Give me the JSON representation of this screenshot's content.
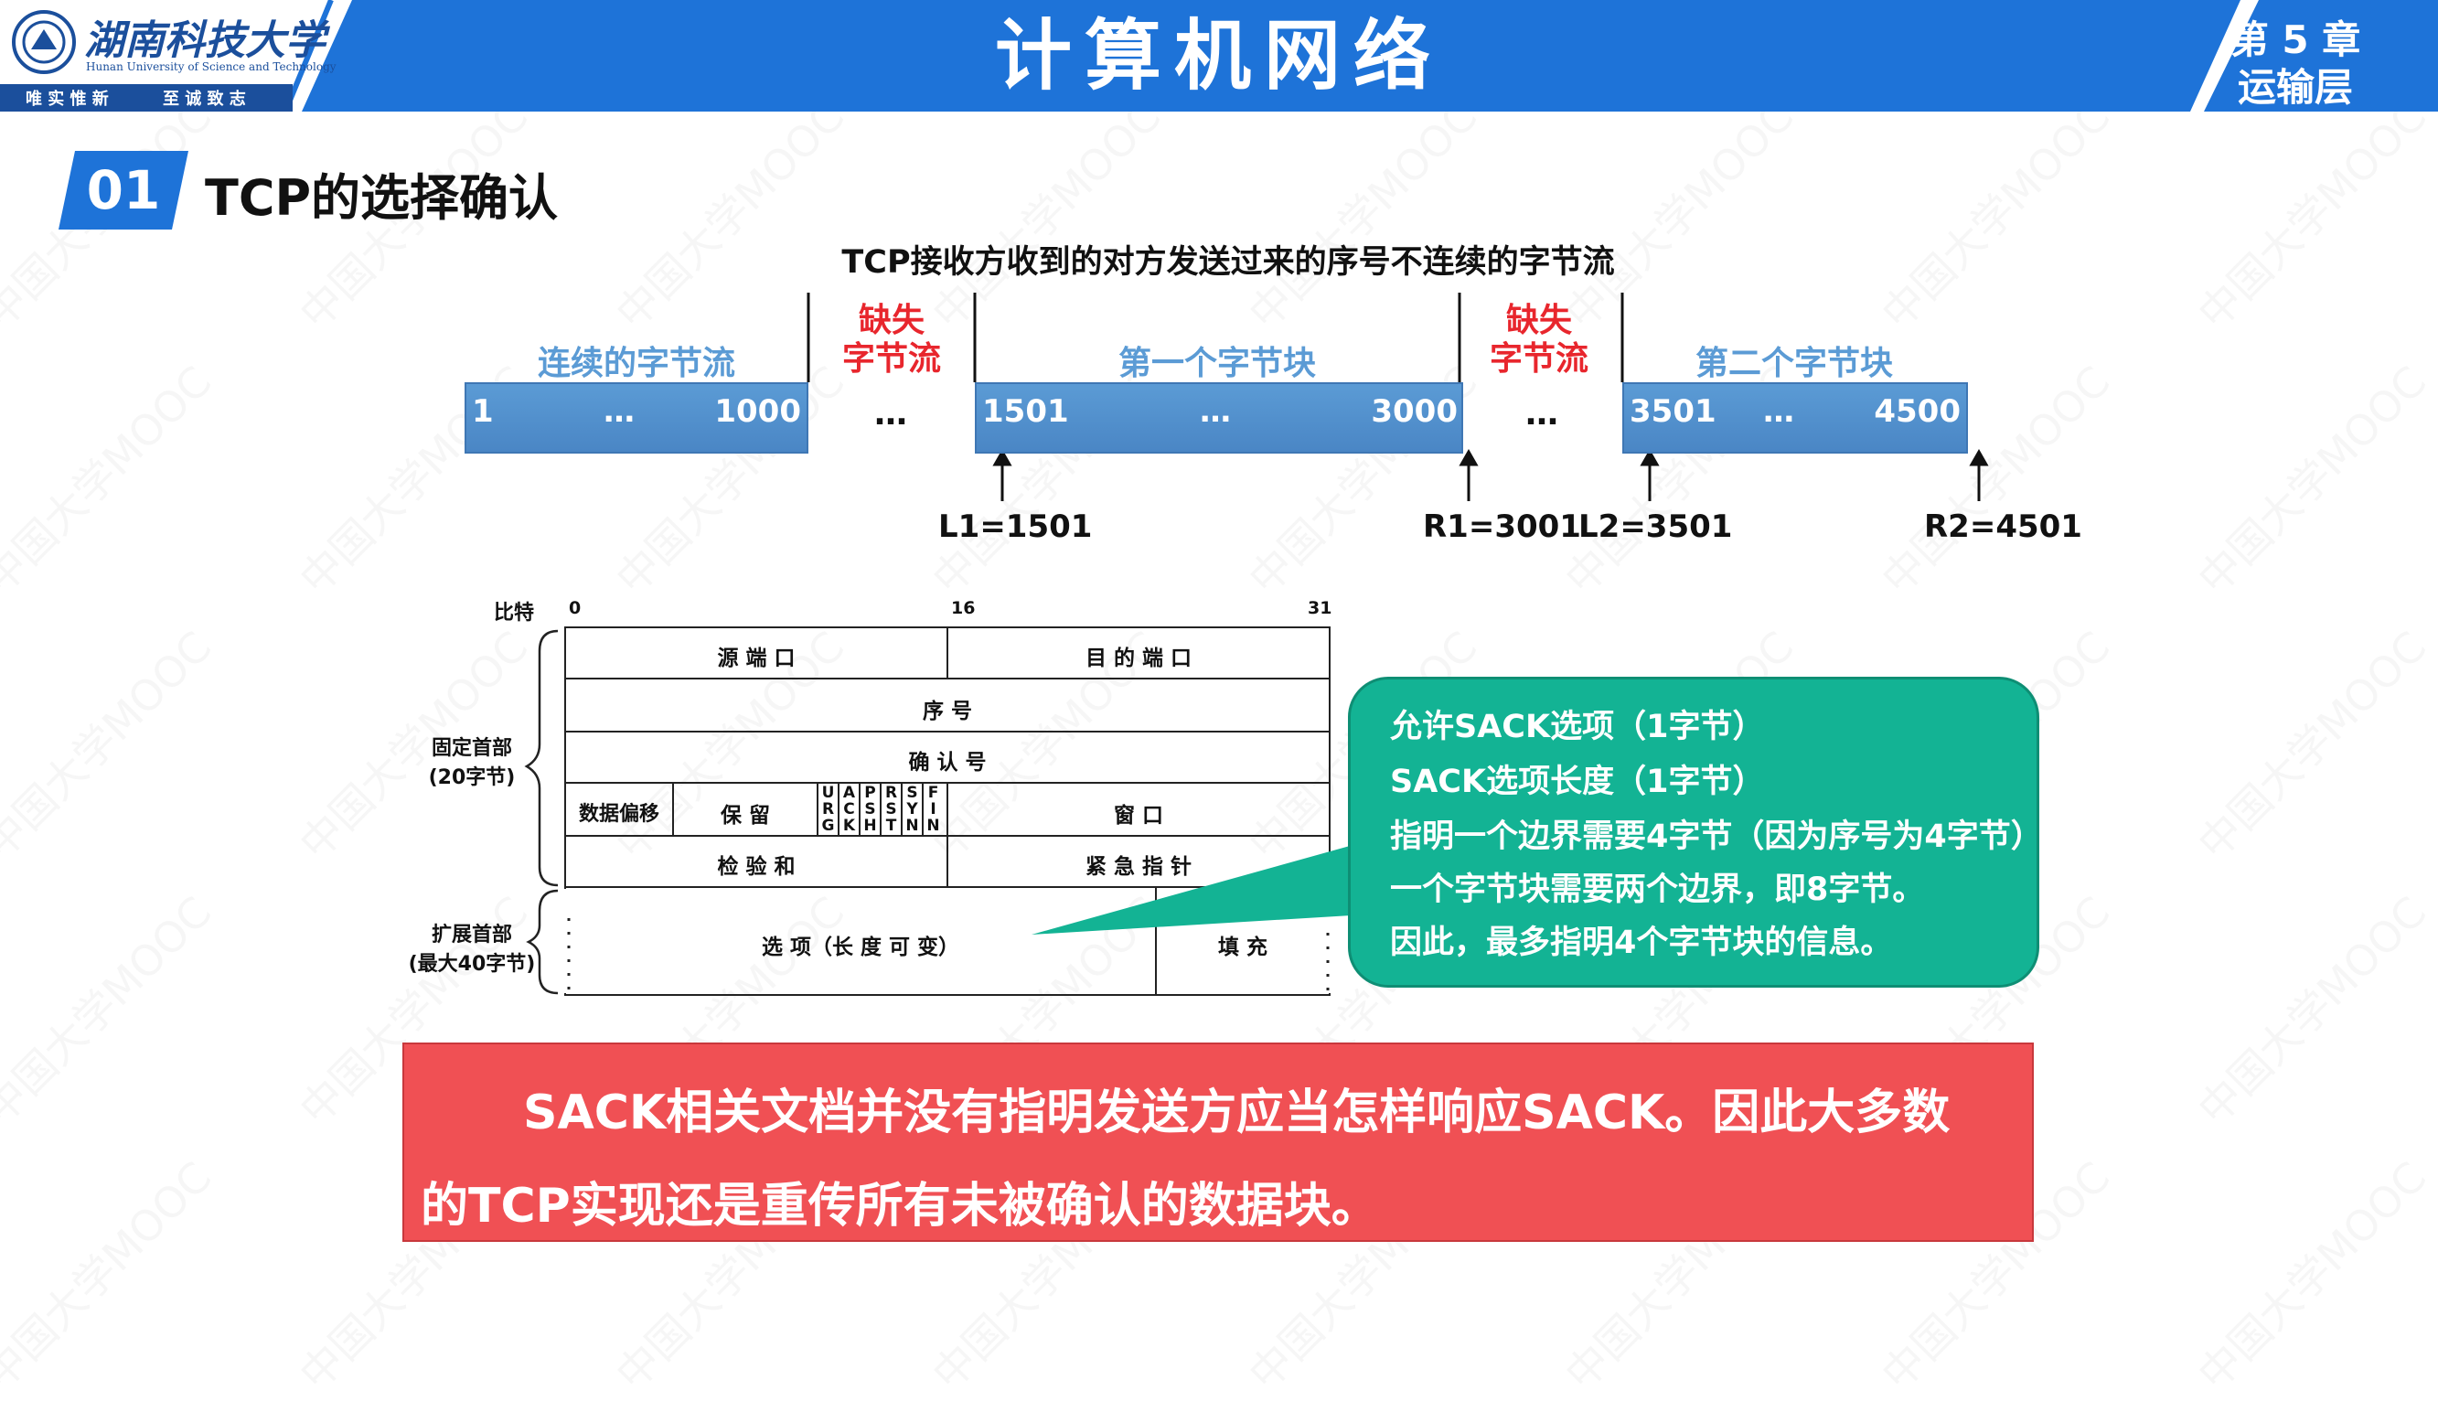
{
  "header": {
    "logo_name": "湖南科技大学",
    "logo_subtitle": "Hunan University of Science and Technology",
    "logo_motto_left": "唯 实 惟 新",
    "logo_motto_right": "至 诚 致 志",
    "title": "计算机网络",
    "chapter_line1": "第 5 章",
    "chapter_line2": "运输层",
    "colors": {
      "band": "#1e73d8",
      "band_light": "#ffffff"
    }
  },
  "section": {
    "number": "01",
    "title": "TCP的选择确认"
  },
  "stream_diagram": {
    "caption": "TCP接收方收到的对方发送过来的序号不连续的字节流",
    "blocks": [
      {
        "label": "连续的字节流",
        "start": "1",
        "mid": "…",
        "end": "1000"
      },
      {
        "label": "第一个字节块",
        "start": "1501",
        "mid": "…",
        "end": "3000"
      },
      {
        "label": "第二个字节块",
        "start": "3501",
        "mid": "…",
        "end": "4500"
      }
    ],
    "gaps": [
      {
        "label_line1": "缺失",
        "label_line2": "字节流",
        "dots": "…"
      },
      {
        "label_line1": "缺失",
        "label_line2": "字节流",
        "dots": "…"
      }
    ],
    "pointers": [
      "L1=1501",
      "R1=3001",
      "L2=3501",
      "R2=4501"
    ]
  },
  "tcp_header": {
    "bit_label": "比特",
    "bit_0": "0",
    "bit_16": "16",
    "bit_31": "31",
    "fixed_label_line1": "固定首部",
    "fixed_label_line2": "(20字节)",
    "ext_label_line1": "扩展首部",
    "ext_label_line2": "(最大40字节)",
    "src_port": "源 端 口",
    "dst_port": "目 的 端 口",
    "seq": "序 号",
    "ack": "确 认 号",
    "offset": "数据偏移",
    "reserved": "保  留",
    "flags": [
      "URG",
      "ACK",
      "PSH",
      "RST",
      "SYN",
      "FIN"
    ],
    "window": "窗  口",
    "checksum": "检 验 和",
    "urgent": "紧 急 指 针",
    "options": "选 项（长 度 可 变）",
    "padding": "填 充"
  },
  "bubble": {
    "lines": [
      "允许SACK选项（1字节）",
      "SACK选项长度（1字节）",
      "指明一个边界需要4字节（因为序号为4字节）",
      "一个字节块需要两个边界，即8字节。",
      "因此，最多指明4个字节块的信息。"
    ]
  },
  "note": {
    "line1": "SACK相关文档并没有指明发送方应当怎样响应SACK。因此大多数",
    "line2": "的TCP实现还是重传所有未被确认的数据块。"
  },
  "watermark": "中国大学MOOC"
}
